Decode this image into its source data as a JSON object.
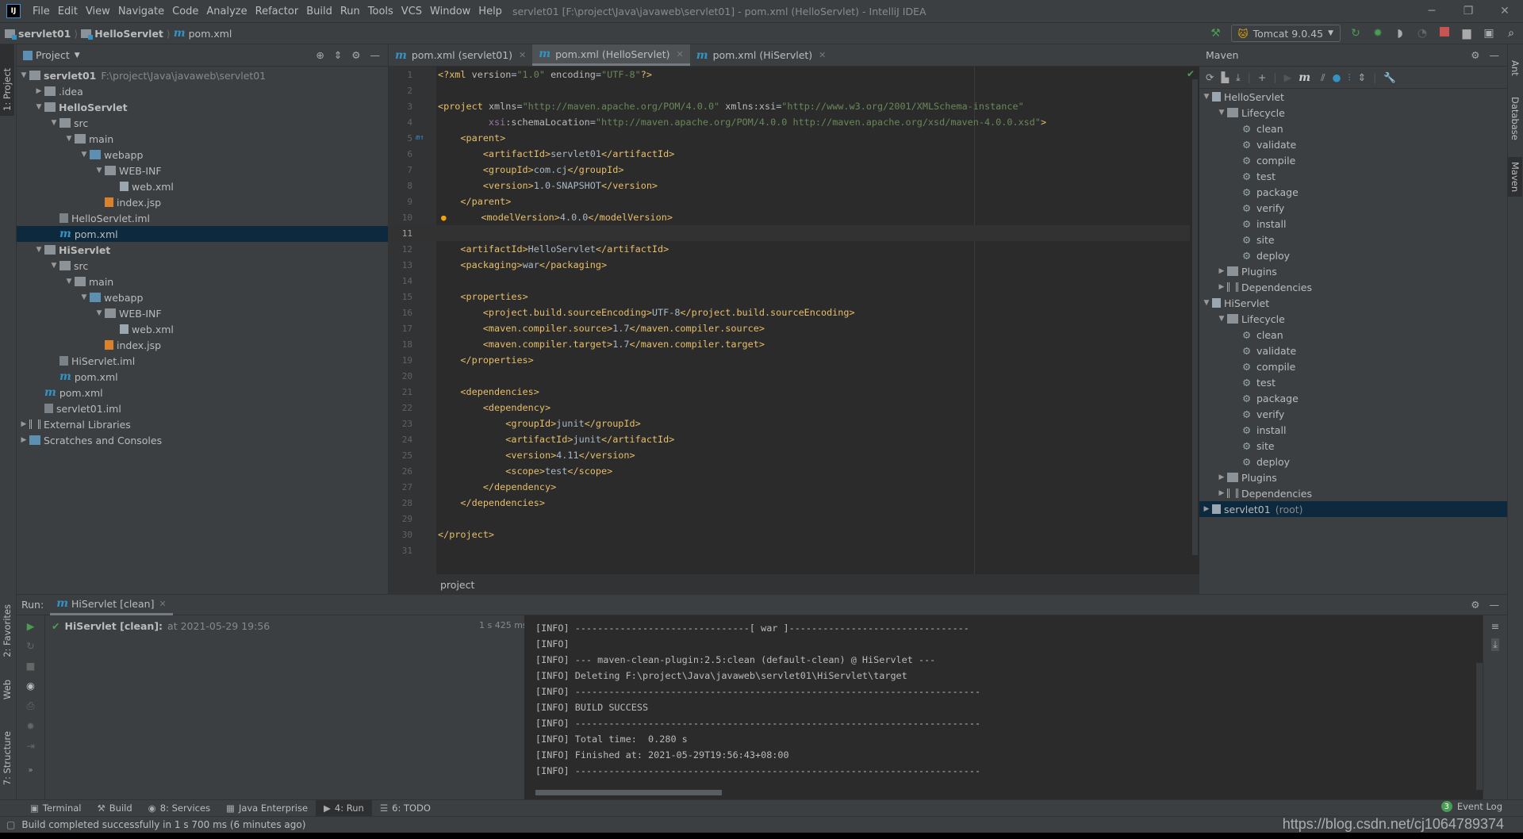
{
  "titlebar": {
    "menus": [
      "File",
      "Edit",
      "View",
      "Navigate",
      "Code",
      "Analyze",
      "Refactor",
      "Build",
      "Run",
      "Tools",
      "VCS",
      "Window",
      "Help"
    ],
    "title": "servlet01 [F:\\project\\Java\\javaweb\\servlet01] - pom.xml (HelloServlet) - IntelliJ IDEA"
  },
  "breadcrumb": [
    "servlet01",
    "HelloServlet",
    "pom.xml"
  ],
  "toolbar": {
    "run_config": "Tomcat 9.0.45",
    "icons": [
      "build-hammer-icon",
      "rerun-icon",
      "debug-icon",
      "coverage-icon",
      "profile-icon",
      "stop-icon",
      "project-structure-icon",
      "run-window-icon",
      "search-icon"
    ]
  },
  "left_stripe": {
    "project": "1: Project",
    "favorites": "2: Favorites",
    "web": "Web",
    "structure": "7: Structure"
  },
  "right_stripe": {
    "ant": "Ant",
    "database": "Database",
    "maven": "Maven"
  },
  "project": {
    "title": "Project",
    "tree": [
      {
        "label": "servlet01",
        "extra": "F:\\project\\Java\\javaweb\\servlet01",
        "lvl": 0,
        "arrow": "open",
        "icon": "module",
        "bold": true
      },
      {
        "label": ".idea",
        "lvl": 1,
        "arrow": "closed",
        "icon": "folder"
      },
      {
        "label": "HelloServlet",
        "lvl": 1,
        "arrow": "open",
        "icon": "module",
        "bold": true
      },
      {
        "label": "src",
        "lvl": 2,
        "arrow": "open",
        "icon": "folder"
      },
      {
        "label": "main",
        "lvl": 3,
        "arrow": "open",
        "icon": "folder"
      },
      {
        "label": "webapp",
        "lvl": 4,
        "arrow": "open",
        "icon": "web"
      },
      {
        "label": "WEB-INF",
        "lvl": 5,
        "arrow": "open",
        "icon": "folder"
      },
      {
        "label": "web.xml",
        "lvl": 6,
        "icon": "file"
      },
      {
        "label": "index.jsp",
        "lvl": 5,
        "icon": "jsp"
      },
      {
        "label": "HelloServlet.iml",
        "lvl": 2,
        "icon": "iml"
      },
      {
        "label": "pom.xml",
        "lvl": 2,
        "icon": "maven",
        "selected": true
      },
      {
        "label": "HiServlet",
        "lvl": 1,
        "arrow": "open",
        "icon": "module",
        "bold": true
      },
      {
        "label": "src",
        "lvl": 2,
        "arrow": "open",
        "icon": "folder"
      },
      {
        "label": "main",
        "lvl": 3,
        "arrow": "open",
        "icon": "folder"
      },
      {
        "label": "webapp",
        "lvl": 4,
        "arrow": "open",
        "icon": "web"
      },
      {
        "label": "WEB-INF",
        "lvl": 5,
        "arrow": "open",
        "icon": "folder"
      },
      {
        "label": "web.xml",
        "lvl": 6,
        "icon": "file"
      },
      {
        "label": "index.jsp",
        "lvl": 5,
        "icon": "jsp"
      },
      {
        "label": "HiServlet.iml",
        "lvl": 2,
        "icon": "iml"
      },
      {
        "label": "pom.xml",
        "lvl": 2,
        "icon": "maven"
      },
      {
        "label": "pom.xml",
        "lvl": 1,
        "icon": "maven"
      },
      {
        "label": "servlet01.iml",
        "lvl": 1,
        "icon": "iml"
      },
      {
        "label": "External Libraries",
        "lvl": 0,
        "arrow": "closed",
        "icon": "lib"
      },
      {
        "label": "Scratches and Consoles",
        "lvl": 0,
        "arrow": "closed",
        "icon": "scratch"
      }
    ]
  },
  "editor": {
    "tabs": [
      {
        "label": "pom.xml (servlet01)"
      },
      {
        "label": "pom.xml (HelloServlet)",
        "active": true
      },
      {
        "label": "pom.xml (HiServlet)"
      }
    ],
    "current_line": 11,
    "lines": [
      "<?xml version=\"1.0\" encoding=\"UTF-8\"?>",
      "",
      "<project xmlns=\"http://maven.apache.org/POM/4.0.0\" xmlns:xsi=\"http://www.w3.org/2001/XMLSchema-instance\"",
      "         xsi:schemaLocation=\"http://maven.apache.org/POM/4.0.0 http://maven.apache.org/xsd/maven-4.0.0.xsd\">",
      "    <parent>",
      "        <artifactId>servlet01</artifactId>",
      "        <groupId>com.cj</groupId>",
      "        <version>1.0-SNAPSHOT</version>",
      "    </parent>",
      "    <modelVersion>4.0.0</modelVersion>",
      "",
      "    <artifactId>HelloServlet</artifactId>",
      "    <packaging>war</packaging>",
      "",
      "    <properties>",
      "        <project.build.sourceEncoding>UTF-8</project.build.sourceEncoding>",
      "        <maven.compiler.source>1.7</maven.compiler.source>",
      "        <maven.compiler.target>1.7</maven.compiler.target>",
      "    </properties>",
      "",
      "    <dependencies>",
      "        <dependency>",
      "            <groupId>junit</groupId>",
      "            <artifactId>junit</artifactId>",
      "            <version>4.11</version>",
      "            <scope>test</scope>",
      "        </dependency>",
      "    </dependencies>",
      "",
      "</project>",
      ""
    ],
    "breadcrumb": "project"
  },
  "maven": {
    "title": "Maven",
    "toolbar_icons": [
      "reload-icon",
      "generate-sources-icon",
      "download-icon",
      "add-icon",
      "run-icon",
      "execute-goal-icon",
      "toggle-offline-icon",
      "skip-tests-icon",
      "show-dependencies-icon",
      "collapse-all-icon",
      "settings-wrench-icon"
    ],
    "tree": [
      {
        "label": "HelloServlet",
        "lvl": 0,
        "arrow": "open",
        "icon": "mproject"
      },
      {
        "label": "Lifecycle",
        "lvl": 1,
        "arrow": "open",
        "icon": "folder"
      },
      {
        "label": "clean",
        "lvl": 2,
        "icon": "gear"
      },
      {
        "label": "validate",
        "lvl": 2,
        "icon": "gear"
      },
      {
        "label": "compile",
        "lvl": 2,
        "icon": "gear"
      },
      {
        "label": "test",
        "lvl": 2,
        "icon": "gear"
      },
      {
        "label": "package",
        "lvl": 2,
        "icon": "gear"
      },
      {
        "label": "verify",
        "lvl": 2,
        "icon": "gear"
      },
      {
        "label": "install",
        "lvl": 2,
        "icon": "gear"
      },
      {
        "label": "site",
        "lvl": 2,
        "icon": "gear"
      },
      {
        "label": "deploy",
        "lvl": 2,
        "icon": "gear"
      },
      {
        "label": "Plugins",
        "lvl": 1,
        "arrow": "closed",
        "icon": "folder"
      },
      {
        "label": "Dependencies",
        "lvl": 1,
        "arrow": "closed",
        "icon": "lib"
      },
      {
        "label": "HiServlet",
        "lvl": 0,
        "arrow": "open",
        "icon": "mproject"
      },
      {
        "label": "Lifecycle",
        "lvl": 1,
        "arrow": "open",
        "icon": "folder"
      },
      {
        "label": "clean",
        "lvl": 2,
        "icon": "gear"
      },
      {
        "label": "validate",
        "lvl": 2,
        "icon": "gear"
      },
      {
        "label": "compile",
        "lvl": 2,
        "icon": "gear"
      },
      {
        "label": "test",
        "lvl": 2,
        "icon": "gear"
      },
      {
        "label": "package",
        "lvl": 2,
        "icon": "gear"
      },
      {
        "label": "verify",
        "lvl": 2,
        "icon": "gear"
      },
      {
        "label": "install",
        "lvl": 2,
        "icon": "gear"
      },
      {
        "label": "site",
        "lvl": 2,
        "icon": "gear"
      },
      {
        "label": "deploy",
        "lvl": 2,
        "icon": "gear"
      },
      {
        "label": "Plugins",
        "lvl": 1,
        "arrow": "closed",
        "icon": "folder"
      },
      {
        "label": "Dependencies",
        "lvl": 1,
        "arrow": "closed",
        "icon": "lib"
      },
      {
        "label": "servlet01",
        "extra": "(root)",
        "lvl": 0,
        "arrow": "closed",
        "icon": "mproject",
        "selected": true
      }
    ]
  },
  "run": {
    "label": "Run:",
    "tab": "HiServlet [clean]",
    "entry_name": "HiServlet [clean]:",
    "entry_time": "at 2021-05-29 19:56",
    "duration": "1 s 425 ms",
    "console": [
      "[INFO] -------------------------------[ war ]--------------------------------",
      "[INFO]",
      "[INFO] --- maven-clean-plugin:2.5:clean (default-clean) @ HiServlet ---",
      "[INFO] Deleting F:\\project\\Java\\javaweb\\servlet01\\HiServlet\\target",
      "[INFO] ------------------------------------------------------------------------",
      "[INFO] BUILD SUCCESS",
      "[INFO] ------------------------------------------------------------------------",
      "[INFO] Total time:  0.280 s",
      "[INFO] Finished at: 2021-05-29T19:56:43+08:00",
      "[INFO] ------------------------------------------------------------------------"
    ]
  },
  "toolwindows": [
    {
      "label": "Terminal",
      "icon": "terminal-icon"
    },
    {
      "label": "Build",
      "icon": "hammer-icon"
    },
    {
      "label": "8: Services",
      "icon": "services-icon"
    },
    {
      "label": "Java Enterprise",
      "icon": "java-enterprise-icon"
    },
    {
      "label": "4: Run",
      "icon": "play-icon",
      "active": true
    },
    {
      "label": "6: TODO",
      "icon": "list-icon"
    }
  ],
  "event_log": {
    "count": "3",
    "label": "Event Log"
  },
  "status": {
    "message": "Build completed successfully in 1 s 700 ms (6 minutes ago)",
    "watermark": "https://blog.csdn.net/cj1064789374"
  },
  "colors": {
    "accent": "#3592c4",
    "success": "#499c54",
    "stop": "#c75450",
    "selection": "#0d293e"
  }
}
